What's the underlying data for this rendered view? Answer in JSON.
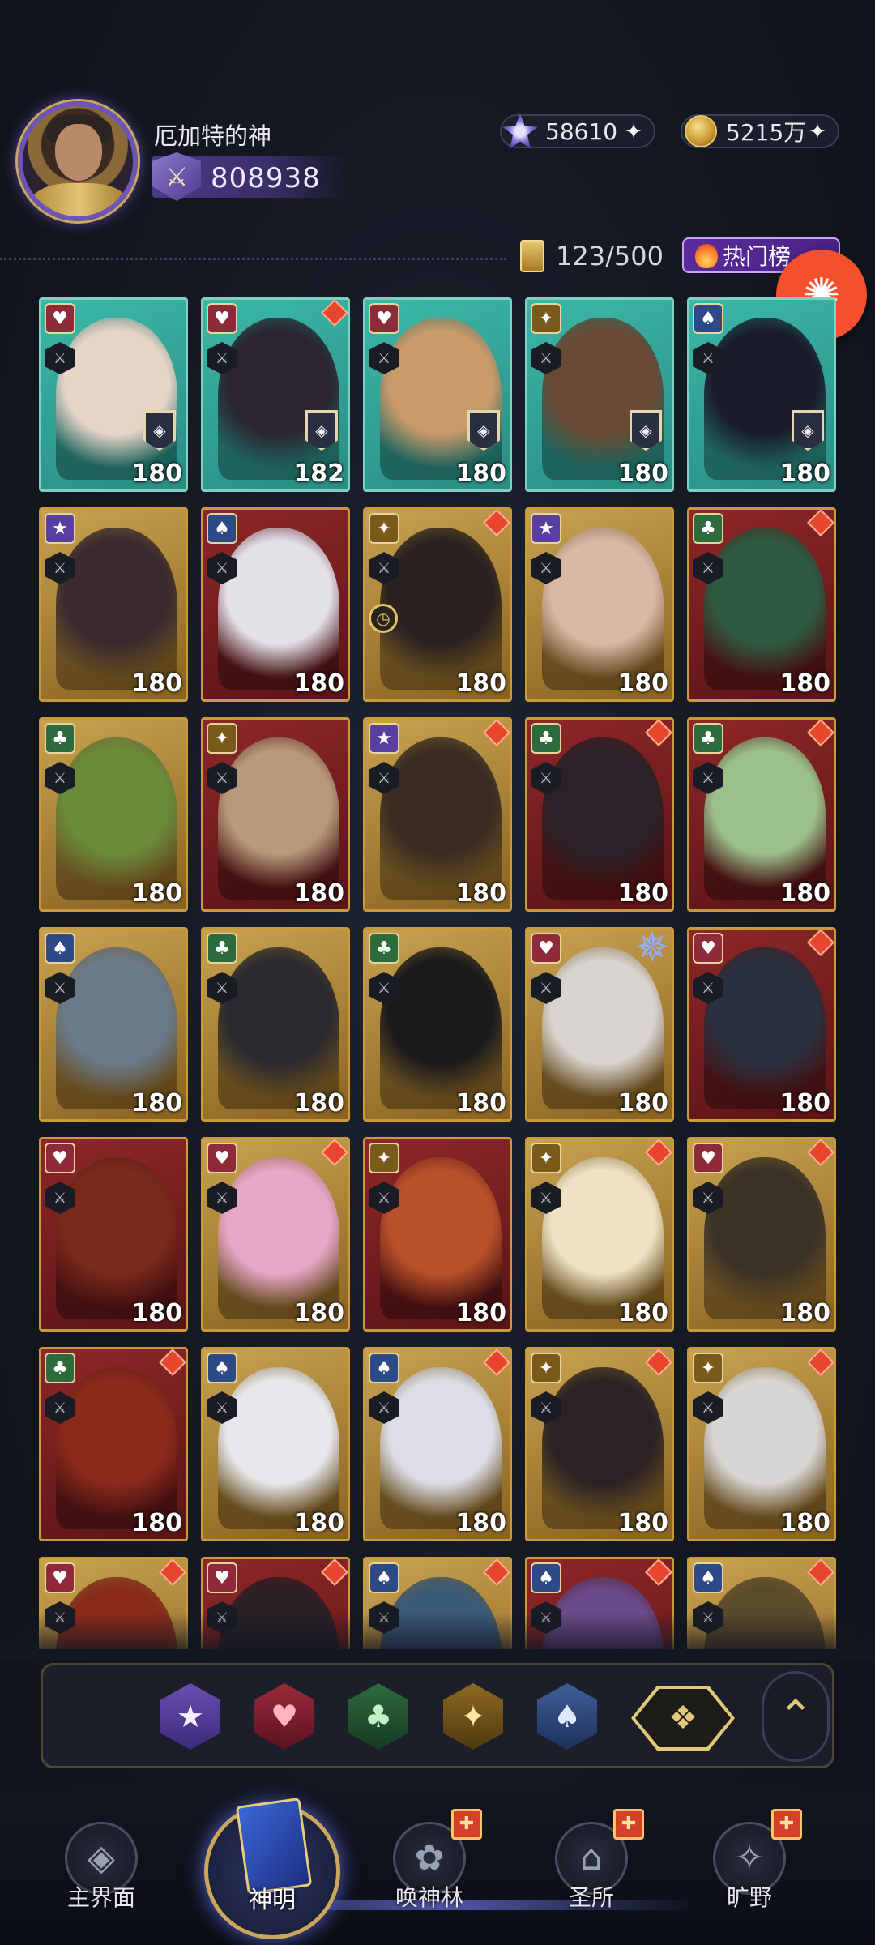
{
  "header": {
    "username": "厄加特的神",
    "power": "808938",
    "gems": "58610",
    "gold": "5215万",
    "capacity": "123/500",
    "hot_label": "热门榜"
  },
  "icons": {
    "plus": "✦",
    "bug": "✺",
    "power": "⚔"
  },
  "cards": [
    {
      "frame": "teal",
      "suit": "♥",
      "suit_color": "#8e2a3a",
      "level": "180",
      "diamond": false,
      "badge": true
    },
    {
      "frame": "teal",
      "suit": "♥",
      "suit_color": "#8e2a3a",
      "level": "182",
      "diamond": true,
      "badge": true
    },
    {
      "frame": "teal",
      "suit": "♥",
      "suit_color": "#8e2a3a",
      "level": "180",
      "diamond": false,
      "badge": true
    },
    {
      "frame": "teal",
      "suit": "✦",
      "suit_color": "#7a5a1a",
      "level": "180",
      "diamond": false,
      "badge": true
    },
    {
      "frame": "teal",
      "suit": "♠",
      "suit_color": "#2e4a86",
      "level": "180",
      "diamond": false,
      "badge": true
    },
    {
      "frame": "gold",
      "suit": "★",
      "suit_color": "#5a3fa0",
      "level": "180",
      "diamond": false,
      "badge": false
    },
    {
      "frame": "red",
      "suit": "♠",
      "suit_color": "#2e4a86",
      "level": "180",
      "diamond": false,
      "badge": false
    },
    {
      "frame": "gold",
      "suit": "✦",
      "suit_color": "#7a5a1a",
      "level": "180",
      "diamond": true,
      "badge": false,
      "clock": true
    },
    {
      "frame": "gold",
      "suit": "★",
      "suit_color": "#5a3fa0",
      "level": "180",
      "diamond": false,
      "badge": false
    },
    {
      "frame": "red",
      "suit": "♣",
      "suit_color": "#2d6a3c",
      "level": "180",
      "diamond": true,
      "badge": false
    },
    {
      "frame": "gold",
      "suit": "♣",
      "suit_color": "#2d6a3c",
      "level": "180",
      "diamond": false,
      "badge": false
    },
    {
      "frame": "red",
      "suit": "✦",
      "suit_color": "#7a5a1a",
      "level": "180",
      "diamond": false,
      "badge": false
    },
    {
      "frame": "gold",
      "suit": "★",
      "suit_color": "#5a3fa0",
      "level": "180",
      "diamond": true,
      "badge": false
    },
    {
      "frame": "red",
      "suit": "♣",
      "suit_color": "#2d6a3c",
      "level": "180",
      "diamond": true,
      "badge": false
    },
    {
      "frame": "red",
      "suit": "♣",
      "suit_color": "#2d6a3c",
      "level": "180",
      "diamond": true,
      "badge": false
    },
    {
      "frame": "gold",
      "suit": "♠",
      "suit_color": "#2e4a86",
      "level": "180",
      "diamond": false,
      "badge": false
    },
    {
      "frame": "gold",
      "suit": "♣",
      "suit_color": "#2d6a3c",
      "level": "180",
      "diamond": false,
      "badge": false
    },
    {
      "frame": "gold",
      "suit": "♣",
      "suit_color": "#2d6a3c",
      "level": "180",
      "diamond": false,
      "badge": false
    },
    {
      "frame": "gold",
      "suit": "♥",
      "suit_color": "#8e2a3a",
      "level": "180",
      "diamond": false,
      "badge": false,
      "star8": true
    },
    {
      "frame": "red",
      "suit": "♥",
      "suit_color": "#8e2a3a",
      "level": "180",
      "diamond": true,
      "badge": false
    },
    {
      "frame": "red",
      "suit": "♥",
      "suit_color": "#8e2a3a",
      "level": "180",
      "diamond": false,
      "badge": false
    },
    {
      "frame": "gold",
      "suit": "♥",
      "suit_color": "#8e2a3a",
      "level": "180",
      "diamond": true,
      "badge": false
    },
    {
      "frame": "red",
      "suit": "✦",
      "suit_color": "#7a5a1a",
      "level": "180",
      "diamond": false,
      "badge": false
    },
    {
      "frame": "gold",
      "suit": "✦",
      "suit_color": "#7a5a1a",
      "level": "180",
      "diamond": true,
      "badge": false
    },
    {
      "frame": "gold",
      "suit": "♥",
      "suit_color": "#8e2a3a",
      "level": "180",
      "diamond": true,
      "badge": false
    },
    {
      "frame": "red",
      "suit": "♣",
      "suit_color": "#2d6a3c",
      "level": "180",
      "diamond": true,
      "badge": false
    },
    {
      "frame": "gold",
      "suit": "♠",
      "suit_color": "#2e4a86",
      "level": "180",
      "diamond": false,
      "badge": false
    },
    {
      "frame": "gold",
      "suit": "♠",
      "suit_color": "#2e4a86",
      "level": "180",
      "diamond": true,
      "badge": false
    },
    {
      "frame": "gold",
      "suit": "✦",
      "suit_color": "#7a5a1a",
      "level": "180",
      "diamond": true,
      "badge": false
    },
    {
      "frame": "gold",
      "suit": "✦",
      "suit_color": "#7a5a1a",
      "level": "180",
      "diamond": true,
      "badge": false
    },
    {
      "frame": "gold",
      "suit": "♥",
      "suit_color": "#8e2a3a",
      "level": "",
      "diamond": true,
      "badge": false
    },
    {
      "frame": "red",
      "suit": "♥",
      "suit_color": "#8e2a3a",
      "level": "",
      "diamond": true,
      "badge": false
    },
    {
      "frame": "gold",
      "suit": "♠",
      "suit_color": "#2e4a86",
      "level": "",
      "diamond": true,
      "badge": false
    },
    {
      "frame": "red",
      "suit": "♠",
      "suit_color": "#2e4a86",
      "level": "",
      "diamond": true,
      "badge": false
    },
    {
      "frame": "gold",
      "suit": "♠",
      "suit_color": "#2e4a86",
      "level": "",
      "diamond": true,
      "badge": false
    }
  ],
  "filters": [
    {
      "name": "star",
      "glyph": "★",
      "style": "purple"
    },
    {
      "name": "heart",
      "glyph": "♥",
      "style": "heart"
    },
    {
      "name": "club",
      "glyph": "♣",
      "style": "club"
    },
    {
      "name": "sparkle",
      "glyph": "✦",
      "style": "gold"
    },
    {
      "name": "spade",
      "glyph": "♠",
      "style": "spade"
    }
  ],
  "filter_all_glyph": "❖",
  "collapse_glyph": "⌃",
  "nav": {
    "main": "主界面",
    "gods": "神明",
    "summon": "唤神林",
    "sanctum": "圣所",
    "wild": "旷野"
  }
}
